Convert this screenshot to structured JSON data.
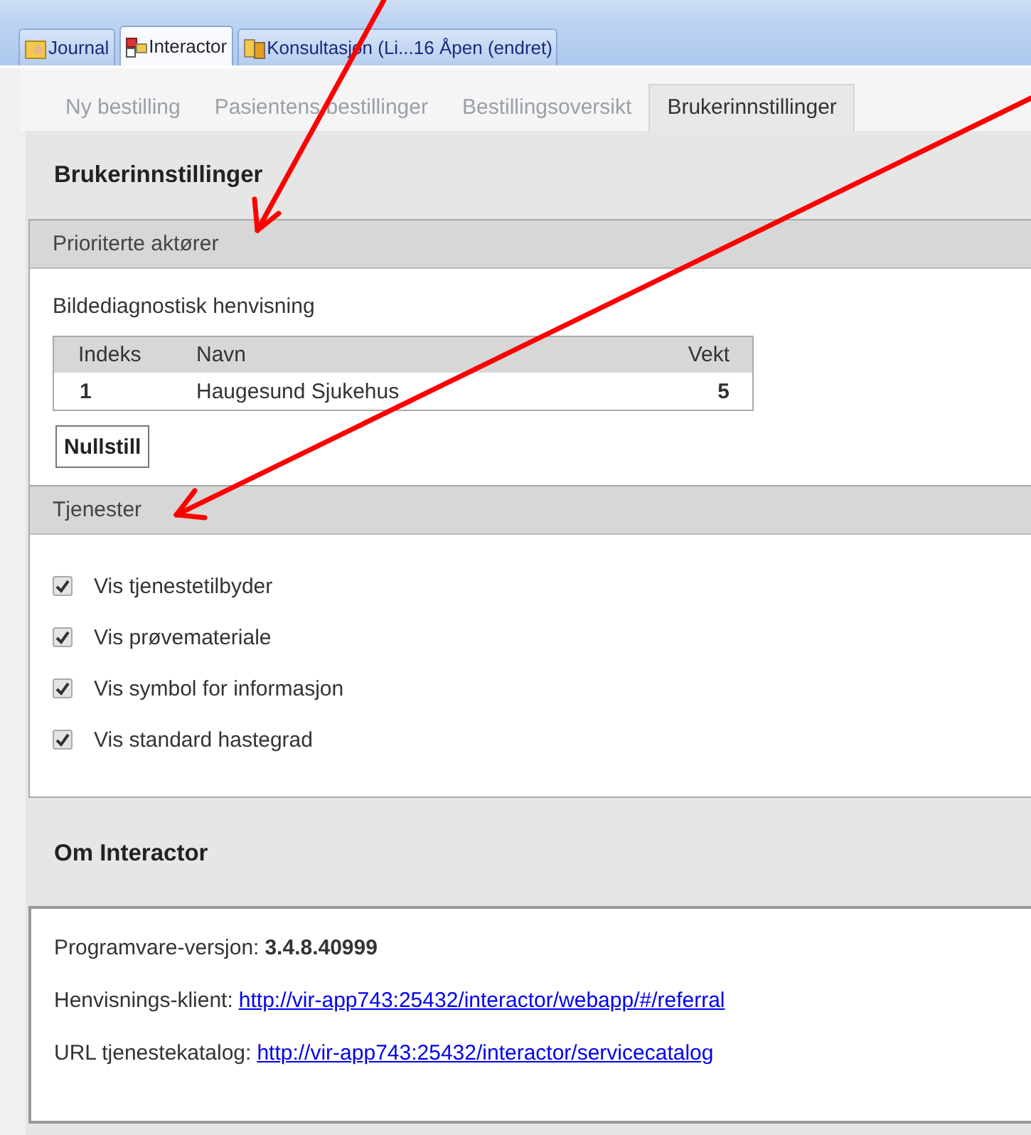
{
  "document_tabs": [
    {
      "label": "Journal",
      "kind": "folder",
      "selected": false
    },
    {
      "label": "Interactor",
      "kind": "blocks",
      "selected": true
    },
    {
      "label": "Konsultasjon (Li...16 Åpen (endret)",
      "kind": "files",
      "selected": false
    }
  ],
  "tabs": [
    {
      "label": "Ny bestilling",
      "selected": false
    },
    {
      "label": "Pasientens bestillinger",
      "selected": false
    },
    {
      "label": "Bestillingsoversikt",
      "selected": false
    },
    {
      "label": "Brukerinnstillinger",
      "selected": true
    }
  ],
  "page_title": "Brukerinnstillinger",
  "sections": [
    {
      "kind": "table",
      "title": "Prioriterte aktører",
      "subtitle": "Bildediagnostisk henvisning",
      "table": {
        "columns": [
          "Indeks",
          "Navn",
          "Vekt"
        ],
        "rows": [
          [
            "1",
            "Haugesund Sjukehus",
            "5"
          ]
        ]
      },
      "button": "Nullstill"
    },
    {
      "kind": "checks",
      "title": "Tjenester",
      "items": [
        {
          "label": "Vis tjenestetilbyder",
          "checked": true
        },
        {
          "label": "Vis prøvemateriale",
          "checked": true
        },
        {
          "label": "Vis symbol for informasjon",
          "checked": true
        },
        {
          "label": "Vis standard hastegrad",
          "checked": true
        }
      ]
    }
  ],
  "about": {
    "title": "Om Interactor",
    "lines": [
      {
        "label": "Programvare-versjon:",
        "value": "3.4.8.40999",
        "kind": "text"
      },
      {
        "label": "Henvisnings-klient:",
        "value": "http://vir-app743:25432/interactor/webapp/#/referral",
        "kind": "link"
      },
      {
        "label": "URL tjenestekatalog:",
        "value": "http://vir-app743:25432/interactor/servicecatalog",
        "kind": "link"
      }
    ]
  }
}
